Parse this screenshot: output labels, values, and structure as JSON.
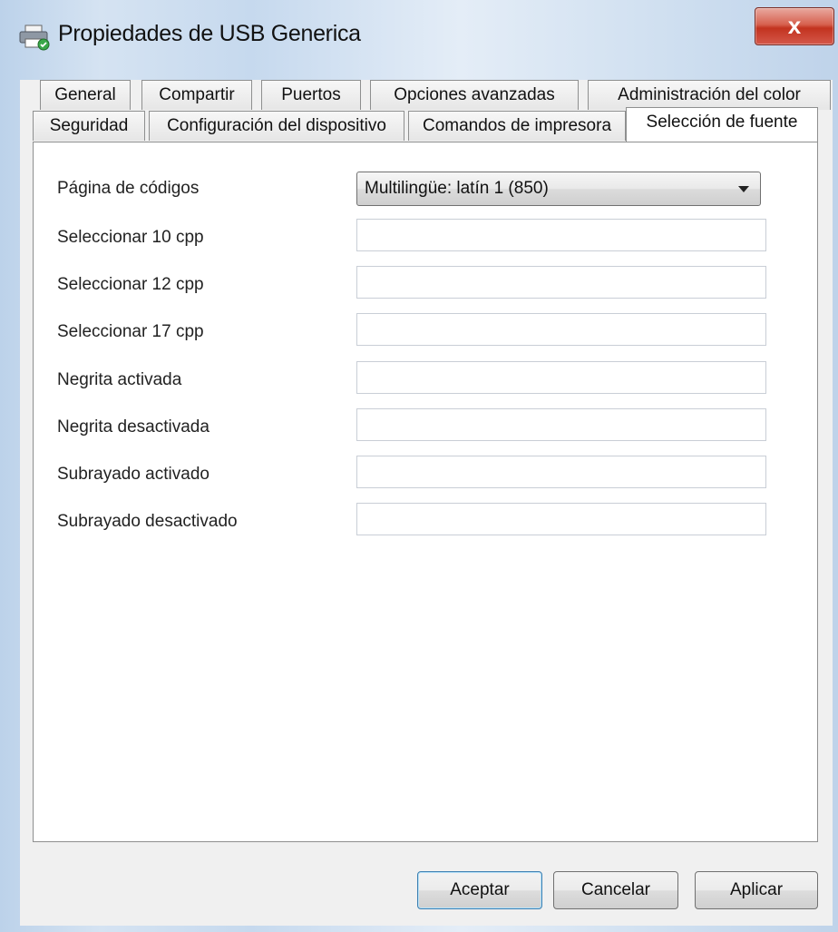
{
  "window": {
    "title": "Propiedades de USB Generica",
    "close_label": "x"
  },
  "tabs": {
    "row1": [
      "General",
      "Compartir",
      "Puertos",
      "Opciones avanzadas",
      "Administración del color"
    ],
    "row2": [
      "Seguridad",
      "Configuración del dispositivo",
      "Comandos de impresora",
      "Selección de fuente"
    ],
    "active": "Selección de fuente"
  },
  "form": {
    "codepage_label": "Página de códigos",
    "codepage_value": "Multilingüe: latín 1 (850)",
    "fields": [
      {
        "label": "Seleccionar 10 cpp",
        "value": ""
      },
      {
        "label": "Seleccionar 12 cpp",
        "value": ""
      },
      {
        "label": "Seleccionar 17 cpp",
        "value": ""
      },
      {
        "label": "Negrita activada",
        "value": ""
      },
      {
        "label": "Negrita desactivada",
        "value": ""
      },
      {
        "label": "Subrayado activado",
        "value": ""
      },
      {
        "label": "Subrayado desactivado",
        "value": ""
      }
    ]
  },
  "buttons": {
    "ok": "Aceptar",
    "cancel": "Cancelar",
    "apply": "Aplicar"
  },
  "colors": {
    "close_red": "#c2331f",
    "border": "#8e8f8f",
    "dialog_bg": "#f0f0f0"
  }
}
